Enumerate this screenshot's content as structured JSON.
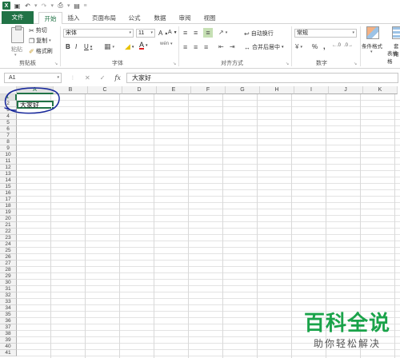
{
  "quick_access": {
    "app_icon": "excel-logo",
    "app_letter": "X"
  },
  "tabs": [
    {
      "label": "文件"
    },
    {
      "label": "开始"
    },
    {
      "label": "插入"
    },
    {
      "label": "页面布局"
    },
    {
      "label": "公式"
    },
    {
      "label": "数据"
    },
    {
      "label": "审阅"
    },
    {
      "label": "视图"
    }
  ],
  "ribbon": {
    "clipboard": {
      "paste": "粘贴",
      "cut": "剪切",
      "copy": "复制",
      "format_painter": "格式刷",
      "group_label": "剪贴板"
    },
    "font": {
      "font_name": "宋体",
      "font_size": "11",
      "grow": "A",
      "shrink": "A",
      "bold": "B",
      "italic": "I",
      "underline": "U",
      "font_color_letter": "A",
      "wen": "wén",
      "group_label": "字体"
    },
    "alignment": {
      "wrap_text": "自动换行",
      "merge_center": "合并后居中",
      "group_label": "对齐方式"
    },
    "number": {
      "format": "常规",
      "percent": "%",
      "comma": ",",
      "group_label": "数字"
    },
    "styles": {
      "conditional_format": "条件格式",
      "table_format": "套用",
      "table_format2": "表格格"
    }
  },
  "formula_bar": {
    "name_box": "A1",
    "fx": "fx",
    "content": "大家好"
  },
  "grid": {
    "columns": [
      "A",
      "B",
      "C",
      "D",
      "E",
      "F",
      "G",
      "H",
      "I",
      "J",
      "K"
    ],
    "rows": [
      "1",
      "2",
      "3",
      "4",
      "5",
      "6",
      "7",
      "8",
      "9",
      "10",
      "11",
      "12",
      "13",
      "14",
      "15",
      "16",
      "17",
      "18",
      "19",
      "20",
      "21",
      "22",
      "23",
      "24",
      "25",
      "26",
      "27",
      "28",
      "29",
      "30",
      "31",
      "32",
      "33",
      "34",
      "35",
      "36",
      "37",
      "38",
      "39",
      "40",
      "41"
    ],
    "active_cell_value": "大家好"
  },
  "watermark": {
    "main": "百科全说",
    "sub": "助你轻松解决"
  },
  "colors": {
    "accent": "#217346",
    "annotation": "#1a2a9c",
    "watermark": "#1aa34a"
  }
}
